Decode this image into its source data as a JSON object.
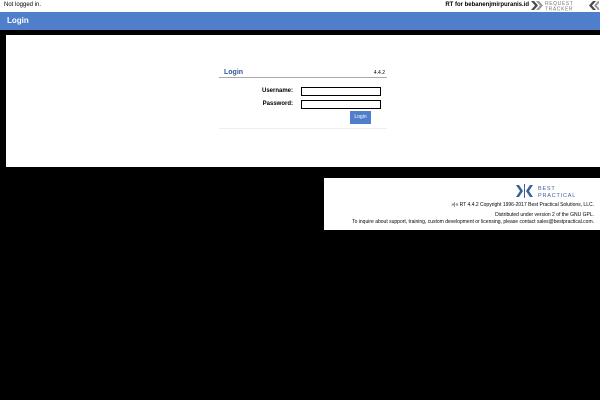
{
  "header": {
    "status_text": "Not logged in.",
    "rt_for_text": "RT for bebanenjmirpuranis.id",
    "logo_text": "REQUEST TRACKER",
    "logo_icon": "rt-logo-icon"
  },
  "page": {
    "title": "Login"
  },
  "login": {
    "box_title": "Login",
    "version": "4.4.2",
    "username_label": "Username:",
    "username_value": "",
    "password_label": "Password:",
    "password_value": "",
    "button_label": "Login"
  },
  "footer": {
    "logo_text_top": "BEST",
    "logo_text_bottom": "PRACTICAL",
    "logo_icon": "best-practical-logo-icon",
    "copyright": "»|« RT 4.4.2 Copyright 1996-2017 Best Practical Solutions, LLC.",
    "license": "Distributed under version 2 of the GNU GPL.",
    "inquiry": "To inquire about support, training, custom development or licensing, please contact sales@bestpractical.com."
  },
  "colors": {
    "accent": "#4f7ecb",
    "title_text": "#335592",
    "background": "#000000",
    "panel": "#ffffff"
  }
}
